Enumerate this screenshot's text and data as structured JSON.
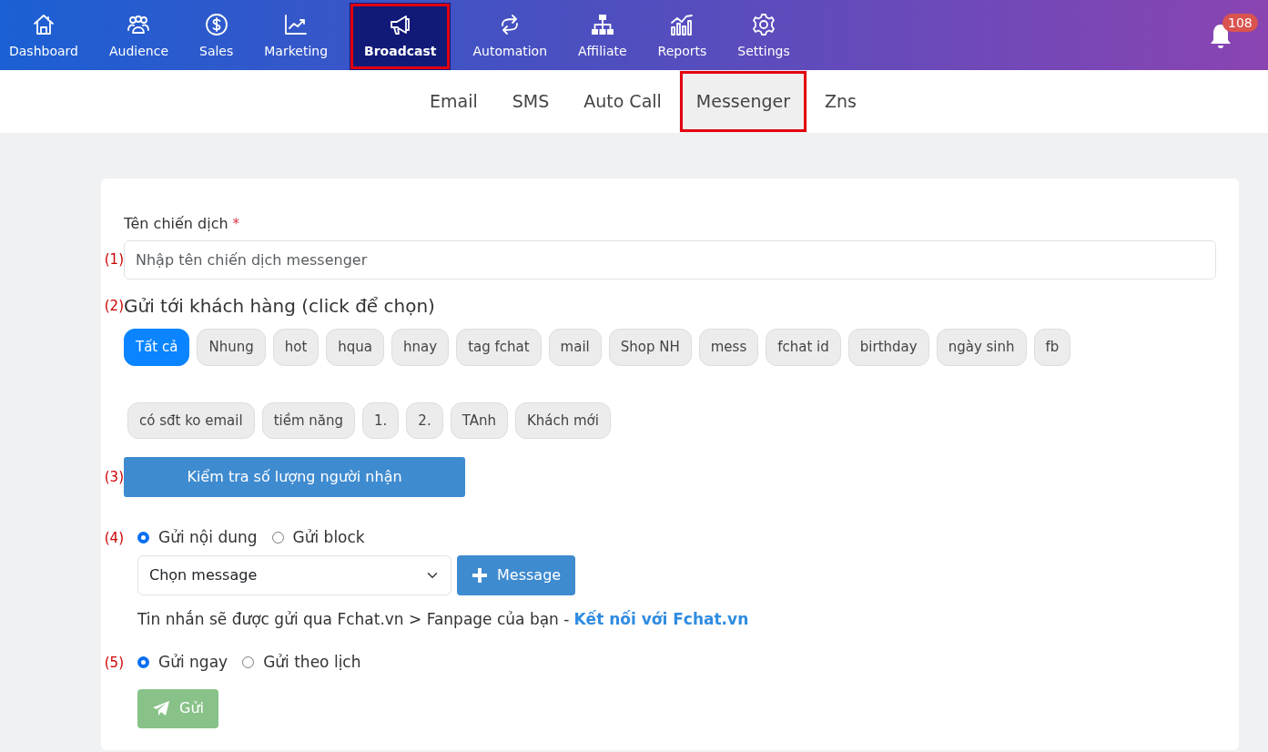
{
  "nav": {
    "items": [
      {
        "label": "Dashboard",
        "selected": false,
        "highlighted": false
      },
      {
        "label": "Audience",
        "selected": false,
        "highlighted": false
      },
      {
        "label": "Sales",
        "selected": false,
        "highlighted": false
      },
      {
        "label": "Marketing",
        "selected": false,
        "highlighted": false
      },
      {
        "label": "Broadcast",
        "selected": true,
        "highlighted": true
      },
      {
        "label": "Automation",
        "selected": false,
        "highlighted": false
      },
      {
        "label": "Affiliate",
        "selected": false,
        "highlighted": false
      },
      {
        "label": "Reports",
        "selected": false,
        "highlighted": false
      },
      {
        "label": "Settings",
        "selected": false,
        "highlighted": false
      }
    ],
    "notifications": {
      "count": "108"
    }
  },
  "subtabs": [
    {
      "label": "Email",
      "selected": false,
      "highlighted": false
    },
    {
      "label": "SMS",
      "selected": false,
      "highlighted": false
    },
    {
      "label": "Auto Call",
      "selected": false,
      "highlighted": false
    },
    {
      "label": "Messenger",
      "selected": true,
      "highlighted": true
    },
    {
      "label": "Zns",
      "selected": false,
      "highlighted": false
    }
  ],
  "campaign_name": {
    "label": "Tên chiến dịch",
    "required_mark": "*",
    "marker": "(1)",
    "placeholder": "Nhập tên chiến dịch messenger"
  },
  "recipients": {
    "marker": "(2)",
    "heading": "Gửi tới khách hàng (click để chọn)",
    "tags": [
      {
        "label": "Tất cả",
        "selected": true
      },
      {
        "label": "Nhung",
        "selected": false
      },
      {
        "label": "hot",
        "selected": false
      },
      {
        "label": "hqua",
        "selected": false
      },
      {
        "label": "hnay",
        "selected": false
      },
      {
        "label": "tag fchat",
        "selected": false
      },
      {
        "label": "mail",
        "selected": false
      },
      {
        "label": "Shop NH",
        "selected": false
      },
      {
        "label": "mess",
        "selected": false
      },
      {
        "label": "fchat id",
        "selected": false
      },
      {
        "label": "birthday",
        "selected": false
      },
      {
        "label": "ngày sinh",
        "selected": false
      },
      {
        "label": "fb",
        "selected": false
      },
      {
        "label": "có sđt ko email",
        "selected": false
      },
      {
        "label": "tiềm năng",
        "selected": false
      },
      {
        "label": "1.",
        "selected": false
      },
      {
        "label": "2.",
        "selected": false
      },
      {
        "label": "TAnh",
        "selected": false
      },
      {
        "label": "Khách mới",
        "selected": false
      }
    ]
  },
  "check_button": {
    "marker": "(3)",
    "label": "Kiểm tra số lượng người nhận"
  },
  "content": {
    "marker": "(4)",
    "options": [
      {
        "label": "Gửi nội dung",
        "selected": true
      },
      {
        "label": "Gửi block",
        "selected": false
      }
    ],
    "select": {
      "value": "Chọn message"
    },
    "add_button": {
      "label": "Message"
    },
    "note": {
      "text": "Tin nhắn sẽ được gửi qua Fchat.vn > Fanpage của bạn -",
      "link": "Kết nối với Fchat.vn"
    }
  },
  "schedule": {
    "marker": "(5)",
    "options": [
      {
        "label": "Gửi ngay",
        "selected": true
      },
      {
        "label": "Gửi theo lịch",
        "selected": false
      }
    ],
    "send_button": {
      "label": "Gửi",
      "disabled": true
    }
  }
}
